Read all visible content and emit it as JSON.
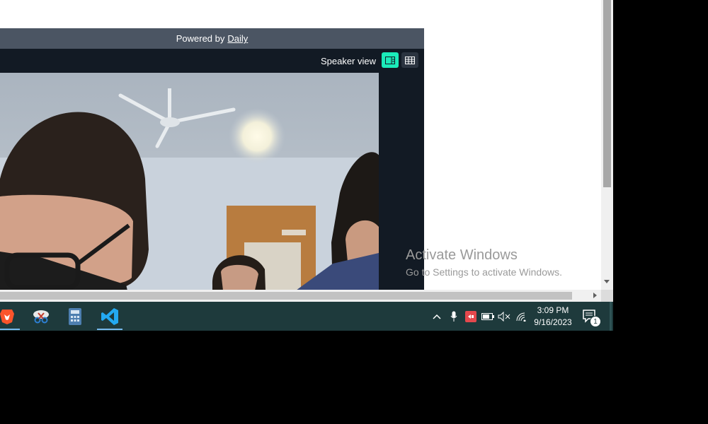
{
  "daily": {
    "powered_prefix": "Powered by",
    "powered_link": "Daily",
    "speaker_view_label": "Speaker view"
  },
  "watermark": {
    "title": "Activate Windows",
    "subtitle": "Go to Settings to activate Windows."
  },
  "taskbar": {
    "apps": [
      "brave-browser",
      "snipping-tool",
      "calculator",
      "visual-studio-code"
    ],
    "time": "3:09 PM",
    "date": "9/16/2023",
    "notification_count": "1"
  },
  "colors": {
    "accent": "#1bebb9",
    "taskbar": "#1e3a3c",
    "frame": "#121a24"
  }
}
